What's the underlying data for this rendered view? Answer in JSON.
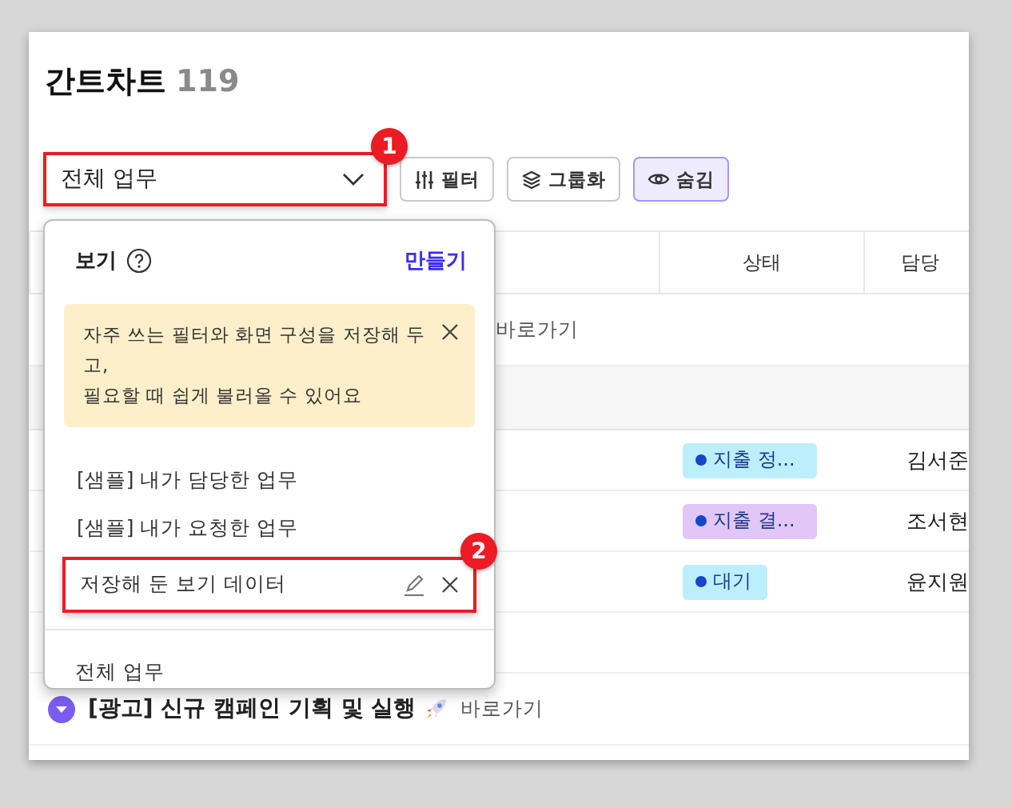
{
  "page": {
    "title": "간트차트",
    "count": "119"
  },
  "toolbar": {
    "view_select": {
      "value": "전체 업무",
      "callout": "1"
    },
    "buttons": [
      {
        "label": "필터",
        "kind": "filter",
        "selected": false
      },
      {
        "label": "그룹화",
        "kind": "group",
        "selected": false
      },
      {
        "label": "숨김",
        "kind": "hide",
        "selected": true
      }
    ]
  },
  "table": {
    "columns": [
      "상태",
      "담당"
    ],
    "rows": [
      {
        "kind": "group",
        "link": "바로가기"
      },
      {
        "kind": "spacer"
      },
      {
        "kind": "task",
        "status": {
          "label": "지출 정...",
          "color": "#bdeefb"
        },
        "assignee": "김서준"
      },
      {
        "kind": "task",
        "status": {
          "label": "지출 결...",
          "color": "#e2c6f7"
        },
        "assignee": "조서현"
      },
      {
        "kind": "task",
        "status": {
          "label": "대기",
          "color": "#bdeefb"
        },
        "assignee": "윤지원"
      },
      {
        "kind": "empty"
      },
      {
        "kind": "group",
        "title": "[광고] 신규 캠페인 기획 및 실행",
        "link": "바로가기"
      }
    ]
  },
  "view_menu": {
    "title": "보기",
    "create": "만들기",
    "notice": "자주 쓰는 필터와 화면 구성을 저장해 두고,\n필요할 때 쉽게 불러올 수 있어요",
    "items": [
      {
        "label": "[샘플] 내가 담당한 업무",
        "editable": false
      },
      {
        "label": "[샘플] 내가 요청한 업무",
        "editable": false
      },
      {
        "label": "저장해 둔 보기 데이터",
        "editable": true,
        "callout": "2"
      }
    ],
    "footer": "전체 업무"
  }
}
